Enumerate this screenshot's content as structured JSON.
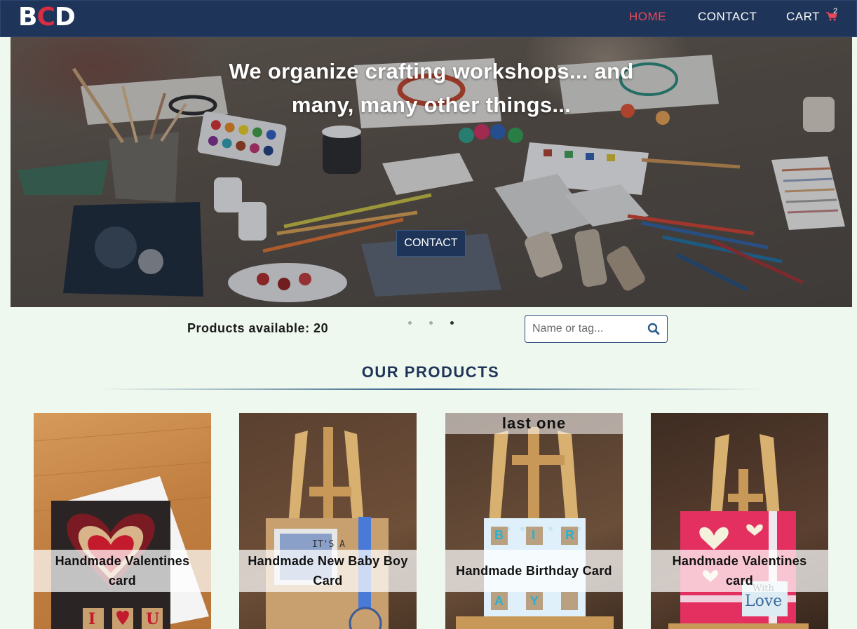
{
  "brand": {
    "logo_part1": "B",
    "logo_part2": "C",
    "logo_part3": "D",
    "logo_colors": [
      "#ffffff",
      "#d92d43",
      "#ffffff"
    ]
  },
  "nav": {
    "home": "HOME",
    "contact": "CONTACT",
    "cart": "CART",
    "cart_count": "2",
    "active_color": "#e8485a",
    "bg_color": "#1e3458"
  },
  "hero": {
    "title_line1": "We organize crafting workshops... and",
    "title_line2": "many, many other things...",
    "cta": "CONTACT",
    "slide_count": 3,
    "active_slide": 3
  },
  "toolbar": {
    "products_available": "Products available: 20",
    "search_placeholder": "Name or tag..."
  },
  "section": {
    "title": "OUR PRODUCTS"
  },
  "products": [
    {
      "name": "Handmade Valentines card",
      "badge": ""
    },
    {
      "name": "Handmade New Baby Boy Card",
      "badge": ""
    },
    {
      "name": "Handmade Birthday Card",
      "badge": "last one"
    },
    {
      "name": "Handmade Valentines card",
      "badge": ""
    }
  ],
  "card_art": {
    "card1_letters": [
      "I",
      "U"
    ],
    "card2_text": "IT'S A",
    "card3_letters": [
      "B",
      "I",
      "R",
      "A",
      "Y"
    ],
    "card4_text_line1": "With",
    "card4_text_line2": "Love"
  }
}
